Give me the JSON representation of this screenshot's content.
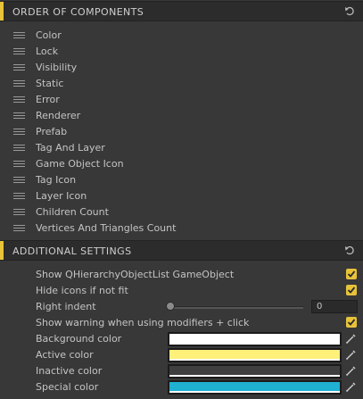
{
  "order_section": {
    "title": "ORDER OF COMPONENTS",
    "items": [
      {
        "label": "Color"
      },
      {
        "label": "Lock"
      },
      {
        "label": "Visibility"
      },
      {
        "label": "Static"
      },
      {
        "label": "Error"
      },
      {
        "label": "Renderer"
      },
      {
        "label": "Prefab"
      },
      {
        "label": "Tag And Layer"
      },
      {
        "label": "Game Object Icon"
      },
      {
        "label": "Tag Icon"
      },
      {
        "label": "Layer Icon"
      },
      {
        "label": "Children Count"
      },
      {
        "label": "Vertices And Triangles Count"
      }
    ]
  },
  "additional_section": {
    "title": "ADDITIONAL SETTINGS",
    "show_object_label": "Show QHierarchyObjectList GameObject",
    "show_object_checked": true,
    "hide_icons_label": "Hide icons if not fit",
    "hide_icons_checked": true,
    "right_indent_label": "Right indent",
    "right_indent_value": "0",
    "show_warning_label": "Show warning when using modifiers + click",
    "show_warning_checked": true,
    "colors": [
      {
        "label": "Background color",
        "color": "#ffffff"
      },
      {
        "label": "Active color",
        "color": "#fff07a"
      },
      {
        "label": "Inactive color",
        "color": "#3f3f3f"
      },
      {
        "label": "Special color",
        "color": "#1fb0d2"
      }
    ]
  },
  "accent_color": "#e8c33a"
}
